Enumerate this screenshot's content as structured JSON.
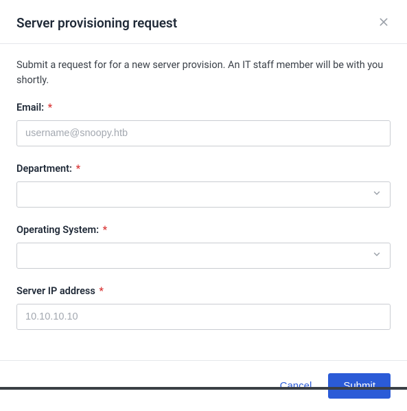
{
  "header": {
    "title": "Server provisioning request"
  },
  "intro": "Submit a request for for a new server provision. An IT staff member will be with you shortly.",
  "form": {
    "email": {
      "label": "Email:",
      "placeholder": "username@snoopy.htb",
      "value": ""
    },
    "department": {
      "label": "Department:",
      "value": ""
    },
    "os": {
      "label": "Operating System:",
      "value": ""
    },
    "server_ip": {
      "label": "Server IP address",
      "placeholder": "10.10.10.10",
      "value": ""
    }
  },
  "footer": {
    "cancel": "Cancel",
    "submit": "Submit"
  },
  "required_marker": "*"
}
